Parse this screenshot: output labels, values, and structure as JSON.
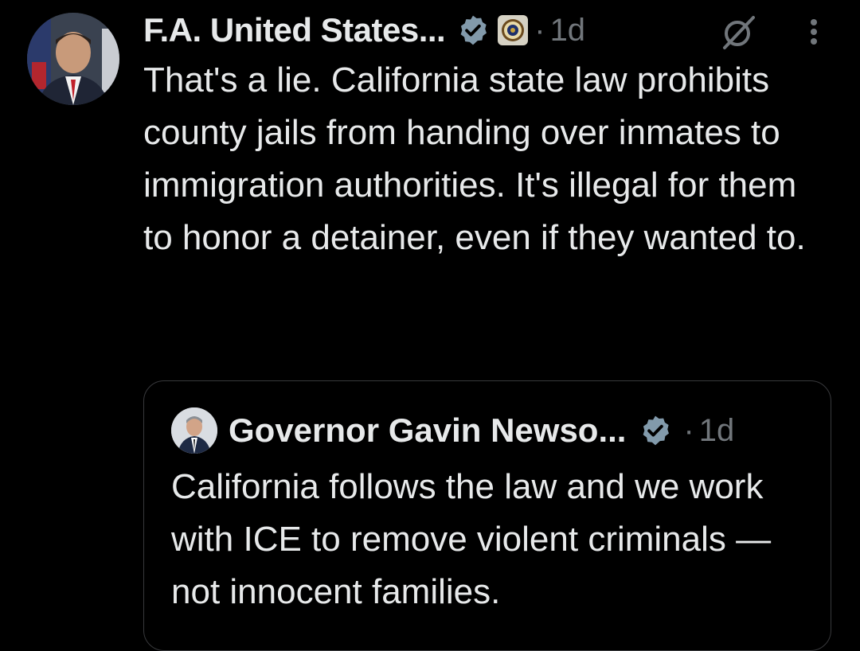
{
  "colors": {
    "background": "#000000",
    "text_primary": "#e7e9ea",
    "text_secondary": "#71767b",
    "verified_badge": "#829aab",
    "quote_border": "#38393c"
  },
  "tweet": {
    "author_name": "F.A. United States...",
    "verified_icon": "verified-badge-icon",
    "affiliation_icon": "doj-seal-icon",
    "separator": "·",
    "time": "1d",
    "grok_icon": "grok-icon",
    "more_icon": "more-options-icon",
    "text": "That's a lie. California state law prohibits county jails from handing over inmates to immigration authorities. It's illegal for them to honor a detainer, even if they wanted to."
  },
  "quoted_tweet": {
    "author_name": "Governor Gavin Newso...",
    "verified_icon": "verified-badge-icon",
    "separator": "·",
    "time": "1d",
    "text": "California follows the law and we work with ICE to remove violent criminals — not innocent families."
  }
}
